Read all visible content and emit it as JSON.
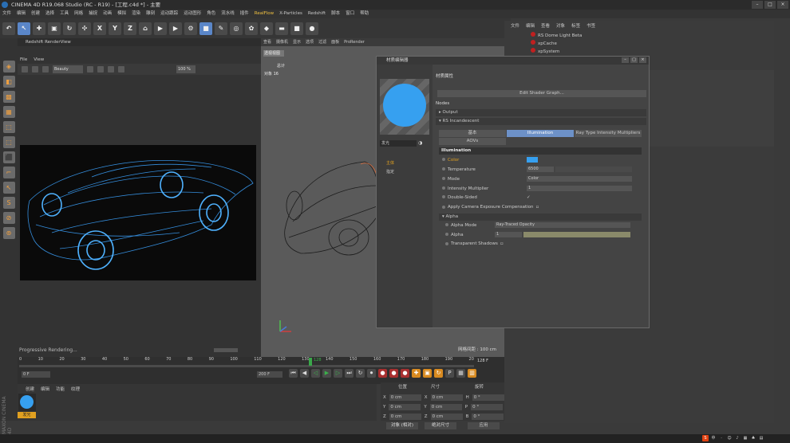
{
  "window": {
    "title": "CINEMA 4D R19.068 Studio (RC - R19) - [工程.c4d *] - 主要",
    "controls": [
      "–",
      "□",
      "×"
    ]
  },
  "menubar": [
    "文件",
    "编辑",
    "创建",
    "选择",
    "工具",
    "网格",
    "捕捉",
    "动画",
    "模拟",
    "渲染",
    "雕刻",
    "运动跟踪",
    "运动图形",
    "角色",
    "流水线",
    "插件",
    "RealFlow",
    "X-Particles",
    "Redshift",
    "脚本",
    "窗口",
    "帮助"
  ],
  "active_menu": "RealFlow",
  "toolbar": {
    "axis": [
      "X",
      "Y",
      "Z"
    ]
  },
  "renderview": {
    "title": "Redshift RenderView",
    "menu": [
      "File",
      "View"
    ],
    "aov": "Beauty",
    "zoom": "100 %",
    "status": "Progressive Rendering..."
  },
  "viewport": {
    "tabs": [
      "查看",
      "摄像机",
      "显示",
      "选项",
      "过滤",
      "面板",
      "ProRender"
    ],
    "name": "透视视图",
    "stats_label": "总计",
    "stats_obj": "对象",
    "stats_count": "16",
    "grid_spacing": "网格间距 : 100 cm"
  },
  "object_manager": {
    "menu": [
      "文件",
      "编辑",
      "查看",
      "对象",
      "标签",
      "书签"
    ],
    "items": [
      "RS Dome Light Beta",
      "xpCache",
      "xpSystem"
    ]
  },
  "material_editor": {
    "title": "材质编辑器",
    "material_name": "发光",
    "channels": [
      "主体",
      "指定"
    ],
    "section": "材质属性",
    "edit_btn": "Edit Shader Graph...",
    "nodes_label": "Nodes",
    "node_output": "Output",
    "node_incandescent": "RS Incandescent",
    "tabs": [
      "基本",
      "Illumination",
      "Ray Type Intensity Multipliers"
    ],
    "tab_aovs": "AOVs",
    "illum_header": "Illumination",
    "props": {
      "color": "Color",
      "temperature": "Temperature",
      "temperature_val": "6500",
      "mode": "Mode",
      "mode_val": "Color",
      "intensity": "Intensity Multiplier",
      "intensity_val": "1",
      "double_sided": "Double-Sided",
      "double_sided_val": "✓",
      "apply_cam": "Apply Camera Exposure Compensation"
    },
    "alpha_header": "Alpha",
    "alpha_props": {
      "mode": "Alpha Mode",
      "mode_val": "Ray-Traced Opacity",
      "alpha": "Alpha",
      "alpha_val": "1",
      "transparent": "Transparent Shadows"
    }
  },
  "timeline": {
    "ticks": [
      "0",
      "10",
      "20",
      "30",
      "40",
      "50",
      "60",
      "70",
      "80",
      "90",
      "100",
      "110",
      "120",
      "130",
      "140",
      "150",
      "160",
      "170",
      "180",
      "190",
      "20"
    ],
    "current": "128",
    "end_label": "128 F",
    "start_field": "0 F",
    "end_field": "200 F"
  },
  "material_manager": {
    "menu": [
      "创建",
      "编辑",
      "功能",
      "纹理"
    ],
    "material": "发光"
  },
  "coordinates": {
    "headers": [
      "位置",
      "尺寸",
      "旋转"
    ],
    "rows": [
      {
        "a": "X",
        "p": "0 cm",
        "s": "0 cm",
        "r": "H",
        "rv": "0 °"
      },
      {
        "a": "Y",
        "p": "0 cm",
        "s": "0 cm",
        "r": "P",
        "rv": "0 °"
      },
      {
        "a": "Z",
        "p": "0 cm",
        "s": "0 cm",
        "r": "B",
        "rv": "0 °"
      }
    ],
    "mode1": "对象 (相对)",
    "mode2": "绝对尺寸",
    "apply": "应用"
  },
  "branding": "MAXON CINEMA 4D",
  "accent": "#36a0f0"
}
